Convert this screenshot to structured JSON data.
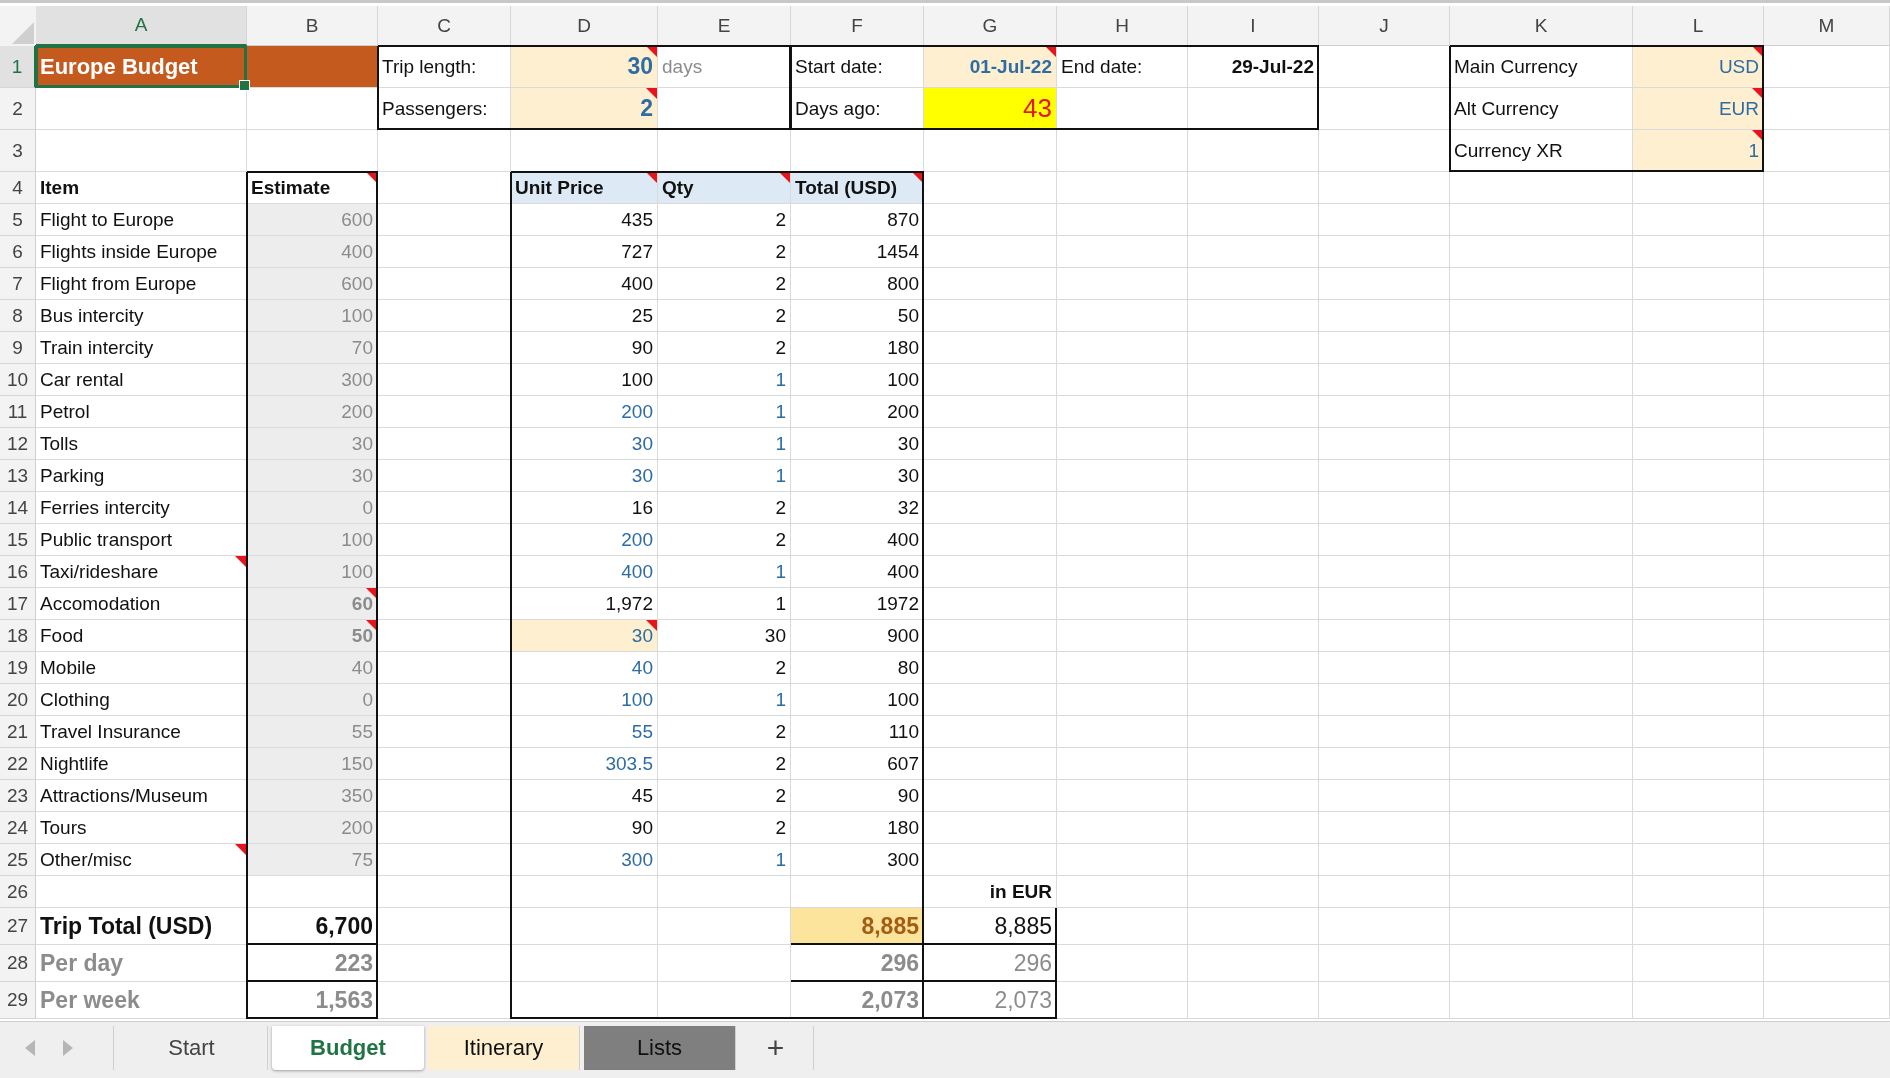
{
  "columns": [
    {
      "label": "A",
      "selected": true
    },
    {
      "label": "B",
      "selected": false
    },
    {
      "label": "C",
      "selected": false
    },
    {
      "label": "D",
      "selected": false
    },
    {
      "label": "E",
      "selected": false
    },
    {
      "label": "F",
      "selected": false
    },
    {
      "label": "G",
      "selected": false
    },
    {
      "label": "H",
      "selected": false
    },
    {
      "label": "I",
      "selected": false
    },
    {
      "label": "J",
      "selected": false
    },
    {
      "label": "K",
      "selected": false
    },
    {
      "label": "L",
      "selected": false
    },
    {
      "label": "M",
      "selected": false
    }
  ],
  "rows": [
    {
      "number": "1",
      "selected": true,
      "cells": {
        "A": {
          "text": "Europe Budget",
          "kind": "title",
          "note": false
        },
        "B": {
          "kind": "title",
          "note": false
        },
        "C": {
          "text": "Trip length:",
          "kind": "label",
          "note": false
        },
        "D": {
          "text": "30",
          "kind": "input-strong",
          "note": true
        },
        "E": {
          "text": "days",
          "kind": "unit",
          "note": false
        },
        "F": {
          "text": "Start date:",
          "kind": "label",
          "note": false
        },
        "G": {
          "text": "01-Jul-22",
          "kind": "input-date",
          "note": true
        },
        "H": {
          "text": "End date:",
          "kind": "label",
          "note": false
        },
        "I": {
          "text": "29-Jul-22",
          "kind": "strong",
          "note": false
        },
        "K": {
          "text": "Main Currency",
          "kind": "label",
          "note": false
        },
        "L": {
          "text": "USD",
          "kind": "input-fill",
          "note": true
        }
      }
    },
    {
      "number": "2",
      "selected": false,
      "cells": {
        "C": {
          "text": "Passengers:",
          "kind": "label",
          "note": false
        },
        "D": {
          "text": "2",
          "kind": "input-strong",
          "note": true
        },
        "F": {
          "text": "Days ago:",
          "kind": "label",
          "note": false
        },
        "G": {
          "text": "43",
          "kind": "alert",
          "note": false
        },
        "K": {
          "text": "Alt Currency",
          "kind": "label",
          "note": false
        },
        "L": {
          "text": "EUR",
          "kind": "input-fill",
          "note": true
        }
      }
    },
    {
      "number": "3",
      "selected": false,
      "cells": {
        "K": {
          "text": "Currency XR",
          "kind": "label",
          "note": false
        },
        "L": {
          "text": "1",
          "kind": "input-fill",
          "note": true
        }
      }
    },
    {
      "number": "4",
      "selected": false,
      "cells": {
        "A": {
          "text": "Item",
          "kind": "header",
          "note": false
        },
        "B": {
          "text": "Estimate",
          "kind": "header",
          "note": true
        },
        "D": {
          "text": "Unit Price",
          "kind": "header-blue",
          "note": true
        },
        "E": {
          "text": "Qty",
          "kind": "header-blue",
          "note": true
        },
        "F": {
          "text": "Total (USD)",
          "kind": "header-blue",
          "note": true
        }
      }
    },
    {
      "number": "5",
      "selected": false,
      "cells": {
        "A": {
          "text": "Flight to Europe",
          "kind": "label",
          "note": false
        },
        "B": {
          "text": "600",
          "kind": "est",
          "note": false
        },
        "D": {
          "text": "435",
          "kind": "num",
          "note": false
        },
        "E": {
          "text": "2",
          "kind": "num",
          "note": false
        },
        "F": {
          "text": "870",
          "kind": "num",
          "note": false
        }
      }
    },
    {
      "number": "6",
      "selected": false,
      "cells": {
        "A": {
          "text": "Flights inside Europe",
          "kind": "label",
          "note": false
        },
        "B": {
          "text": "400",
          "kind": "est",
          "note": false
        },
        "D": {
          "text": "727",
          "kind": "num",
          "note": false
        },
        "E": {
          "text": "2",
          "kind": "num",
          "note": false
        },
        "F": {
          "text": "1454",
          "kind": "num",
          "note": false
        }
      }
    },
    {
      "number": "7",
      "selected": false,
      "cells": {
        "A": {
          "text": "Flight from Europe",
          "kind": "label",
          "note": false
        },
        "B": {
          "text": "600",
          "kind": "est",
          "note": false
        },
        "D": {
          "text": "400",
          "kind": "num",
          "note": false
        },
        "E": {
          "text": "2",
          "kind": "num",
          "note": false
        },
        "F": {
          "text": "800",
          "kind": "num",
          "note": false
        }
      }
    },
    {
      "number": "8",
      "selected": false,
      "cells": {
        "A": {
          "text": "Bus intercity",
          "kind": "label",
          "note": false
        },
        "B": {
          "text": "100",
          "kind": "est",
          "note": false
        },
        "D": {
          "text": "25",
          "kind": "num",
          "note": false
        },
        "E": {
          "text": "2",
          "kind": "num",
          "note": false
        },
        "F": {
          "text": "50",
          "kind": "num",
          "note": false
        }
      }
    },
    {
      "number": "9",
      "selected": false,
      "cells": {
        "A": {
          "text": "Train intercity",
          "kind": "label",
          "note": false
        },
        "B": {
          "text": "70",
          "kind": "est",
          "note": false
        },
        "D": {
          "text": "90",
          "kind": "num",
          "note": false
        },
        "E": {
          "text": "2",
          "kind": "num",
          "note": false
        },
        "F": {
          "text": "180",
          "kind": "num",
          "note": false
        }
      }
    },
    {
      "number": "10",
      "selected": false,
      "cells": {
        "A": {
          "text": "Car rental",
          "kind": "label",
          "note": false
        },
        "B": {
          "text": "300",
          "kind": "est",
          "note": false
        },
        "D": {
          "text": "100",
          "kind": "num",
          "note": false
        },
        "E": {
          "text": "1",
          "kind": "input",
          "note": false
        },
        "F": {
          "text": "100",
          "kind": "num",
          "note": false
        }
      }
    },
    {
      "number": "11",
      "selected": false,
      "cells": {
        "A": {
          "text": "Petrol",
          "kind": "label",
          "note": false
        },
        "B": {
          "text": "200",
          "kind": "est",
          "note": false
        },
        "D": {
          "text": "200",
          "kind": "input",
          "note": false
        },
        "E": {
          "text": "1",
          "kind": "input",
          "note": false
        },
        "F": {
          "text": "200",
          "kind": "num",
          "note": false
        }
      }
    },
    {
      "number": "12",
      "selected": false,
      "cells": {
        "A": {
          "text": "Tolls",
          "kind": "label",
          "note": false
        },
        "B": {
          "text": "30",
          "kind": "est",
          "note": false
        },
        "D": {
          "text": "30",
          "kind": "input",
          "note": false
        },
        "E": {
          "text": "1",
          "kind": "input",
          "note": false
        },
        "F": {
          "text": "30",
          "kind": "num",
          "note": false
        }
      }
    },
    {
      "number": "13",
      "selected": false,
      "cells": {
        "A": {
          "text": "Parking",
          "kind": "label",
          "note": false
        },
        "B": {
          "text": "30",
          "kind": "est",
          "note": false
        },
        "D": {
          "text": "30",
          "kind": "input",
          "note": false
        },
        "E": {
          "text": "1",
          "kind": "input",
          "note": false
        },
        "F": {
          "text": "30",
          "kind": "num",
          "note": false
        }
      }
    },
    {
      "number": "14",
      "selected": false,
      "cells": {
        "A": {
          "text": "Ferries intercity",
          "kind": "label",
          "note": false
        },
        "B": {
          "text": "0",
          "kind": "est",
          "note": false
        },
        "D": {
          "text": "16",
          "kind": "num",
          "note": false
        },
        "E": {
          "text": "2",
          "kind": "num",
          "note": false
        },
        "F": {
          "text": "32",
          "kind": "num",
          "note": false
        }
      }
    },
    {
      "number": "15",
      "selected": false,
      "cells": {
        "A": {
          "text": "Public transport",
          "kind": "label",
          "note": false
        },
        "B": {
          "text": "100",
          "kind": "est",
          "note": false
        },
        "D": {
          "text": "200",
          "kind": "input",
          "note": false
        },
        "E": {
          "text": "2",
          "kind": "num",
          "note": false
        },
        "F": {
          "text": "400",
          "kind": "num",
          "note": false
        }
      }
    },
    {
      "number": "16",
      "selected": false,
      "cells": {
        "A": {
          "text": "Taxi/rideshare",
          "kind": "label",
          "note": true
        },
        "B": {
          "text": "100",
          "kind": "est",
          "note": false
        },
        "D": {
          "text": "400",
          "kind": "input",
          "note": false
        },
        "E": {
          "text": "1",
          "kind": "input",
          "note": false
        },
        "F": {
          "text": "400",
          "kind": "num",
          "note": false
        }
      }
    },
    {
      "number": "17",
      "selected": false,
      "cells": {
        "A": {
          "text": "Accomodation",
          "kind": "label",
          "note": false
        },
        "B": {
          "text": "60",
          "kind": "est-bold",
          "note": true
        },
        "D": {
          "text": "1,972",
          "kind": "num",
          "note": false
        },
        "E": {
          "text": "1",
          "kind": "num",
          "note": false
        },
        "F": {
          "text": "1972",
          "kind": "num",
          "note": false
        }
      }
    },
    {
      "number": "18",
      "selected": false,
      "cells": {
        "A": {
          "text": "Food",
          "kind": "label",
          "note": false
        },
        "B": {
          "text": "50",
          "kind": "est-bold",
          "note": true
        },
        "D": {
          "text": "30",
          "kind": "input-fill",
          "note": true
        },
        "E": {
          "text": "30",
          "kind": "num",
          "note": false
        },
        "F": {
          "text": "900",
          "kind": "num",
          "note": false
        }
      }
    },
    {
      "number": "19",
      "selected": false,
      "cells": {
        "A": {
          "text": "Mobile",
          "kind": "label",
          "note": false
        },
        "B": {
          "text": "40",
          "kind": "est",
          "note": false
        },
        "D": {
          "text": "40",
          "kind": "input",
          "note": false
        },
        "E": {
          "text": "2",
          "kind": "num",
          "note": false
        },
        "F": {
          "text": "80",
          "kind": "num",
          "note": false
        }
      }
    },
    {
      "number": "20",
      "selected": false,
      "cells": {
        "A": {
          "text": "Clothing",
          "kind": "label",
          "note": false
        },
        "B": {
          "text": "0",
          "kind": "est",
          "note": false
        },
        "D": {
          "text": "100",
          "kind": "input",
          "note": false
        },
        "E": {
          "text": "1",
          "kind": "input",
          "note": false
        },
        "F": {
          "text": "100",
          "kind": "num",
          "note": false
        }
      }
    },
    {
      "number": "21",
      "selected": false,
      "cells": {
        "A": {
          "text": "Travel Insurance",
          "kind": "label",
          "note": false
        },
        "B": {
          "text": "55",
          "kind": "est",
          "note": false
        },
        "D": {
          "text": "55",
          "kind": "input",
          "note": false
        },
        "E": {
          "text": "2",
          "kind": "num",
          "note": false
        },
        "F": {
          "text": "110",
          "kind": "num",
          "note": false
        }
      }
    },
    {
      "number": "22",
      "selected": false,
      "cells": {
        "A": {
          "text": "Nightlife",
          "kind": "label",
          "note": false
        },
        "B": {
          "text": "150",
          "kind": "est",
          "note": false
        },
        "D": {
          "text": "303.5",
          "kind": "input",
          "note": false
        },
        "E": {
          "text": "2",
          "kind": "num",
          "note": false
        },
        "F": {
          "text": "607",
          "kind": "num",
          "note": false
        }
      }
    },
    {
      "number": "23",
      "selected": false,
      "cells": {
        "A": {
          "text": "Attractions/Museum",
          "kind": "label",
          "note": false
        },
        "B": {
          "text": "350",
          "kind": "est",
          "note": false
        },
        "D": {
          "text": "45",
          "kind": "num",
          "note": false
        },
        "E": {
          "text": "2",
          "kind": "num",
          "note": false
        },
        "F": {
          "text": "90",
          "kind": "num",
          "note": false
        }
      }
    },
    {
      "number": "24",
      "selected": false,
      "cells": {
        "A": {
          "text": "Tours",
          "kind": "label",
          "note": false
        },
        "B": {
          "text": "200",
          "kind": "est",
          "note": false
        },
        "D": {
          "text": "90",
          "kind": "num",
          "note": false
        },
        "E": {
          "text": "2",
          "kind": "num",
          "note": false
        },
        "F": {
          "text": "180",
          "kind": "num",
          "note": false
        }
      }
    },
    {
      "number": "25",
      "selected": false,
      "cells": {
        "A": {
          "text": "Other/misc",
          "kind": "label",
          "note": true
        },
        "B": {
          "text": "75",
          "kind": "est",
          "note": false
        },
        "D": {
          "text": "300",
          "kind": "input",
          "note": false
        },
        "E": {
          "text": "1",
          "kind": "input",
          "note": false
        },
        "F": {
          "text": "300",
          "kind": "num",
          "note": false
        }
      }
    },
    {
      "number": "26",
      "selected": false,
      "cells": {
        "G": {
          "text": "in EUR",
          "kind": "strong",
          "note": false
        }
      }
    },
    {
      "number": "27",
      "selected": false,
      "cells": {
        "A": {
          "text": "Trip Total (USD)",
          "kind": "total-label",
          "note": false
        },
        "B": {
          "text": "6,700",
          "kind": "total",
          "note": false
        },
        "F": {
          "text": "8,885",
          "kind": "gold",
          "note": false
        },
        "G": {
          "text": "8,885",
          "kind": "big",
          "note": false
        }
      }
    },
    {
      "number": "28",
      "selected": false,
      "cells": {
        "A": {
          "text": "Per day",
          "kind": "sub-label",
          "note": false
        },
        "B": {
          "text": "223",
          "kind": "sub-total",
          "note": false
        },
        "F": {
          "text": "296",
          "kind": "sub-total",
          "note": false
        },
        "G": {
          "text": "296",
          "kind": "big-muted",
          "note": false
        }
      }
    },
    {
      "number": "29",
      "selected": false,
      "cells": {
        "A": {
          "text": "Per week",
          "kind": "sub-label",
          "note": false
        },
        "B": {
          "text": "1,563",
          "kind": "sub-total",
          "note": false
        },
        "F": {
          "text": "2,073",
          "kind": "sub-total",
          "note": false
        },
        "G": {
          "text": "2,073",
          "kind": "big-muted",
          "note": false
        }
      }
    }
  ],
  "sheet_tabs": [
    {
      "label": "Start",
      "selected": false
    },
    {
      "label": "Budget",
      "selected": true
    },
    {
      "label": "Itinerary",
      "selected": false,
      "color": "#fdefd0"
    },
    {
      "label": "Lists",
      "selected": false,
      "color": "#7f7f7f"
    }
  ],
  "add_sheet": "+"
}
